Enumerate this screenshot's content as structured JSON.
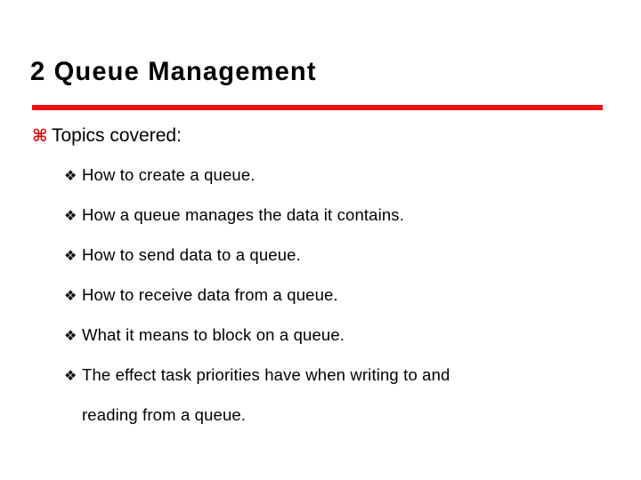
{
  "slide": {
    "title": "2 Queue Management",
    "accent_color": "#ee1111",
    "bullet_color": "#d71010",
    "text_color": "#000000",
    "background_color": "#ffffff",
    "divider": {
      "name": "red-rule",
      "color": "#ee1111"
    },
    "bullets": [
      {
        "level": 1,
        "marker": "⌘",
        "marker_name": "command-bullet-icon",
        "text": "Topics covered:"
      },
      {
        "level": 2,
        "marker": "❖",
        "marker_name": "diamond-bullet-icon",
        "text": "How to create a queue."
      },
      {
        "level": 2,
        "marker": "❖",
        "marker_name": "diamond-bullet-icon",
        "text": "How a queue manages the data it contains."
      },
      {
        "level": 2,
        "marker": "❖",
        "marker_name": "diamond-bullet-icon",
        "text": "How to send data to a queue."
      },
      {
        "level": 2,
        "marker": "❖",
        "marker_name": "diamond-bullet-icon",
        "text": "How to receive data from a queue."
      },
      {
        "level": 2,
        "marker": "❖",
        "marker_name": "diamond-bullet-icon",
        "text": "What it means to block on a queue."
      },
      {
        "level": 2,
        "marker": "❖",
        "marker_name": "diamond-bullet-icon",
        "text": "The effect task priorities have when writing to and"
      },
      {
        "level": 0,
        "marker": "",
        "marker_name": "no-bullet",
        "text": "reading from a queue."
      }
    ]
  }
}
